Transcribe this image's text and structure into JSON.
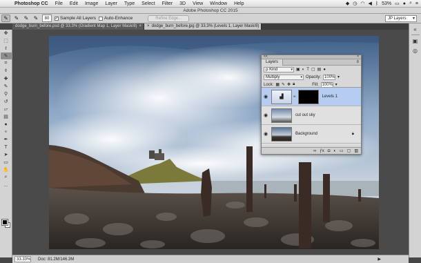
{
  "menubar": {
    "app_name": "Photoshop CC",
    "menus": [
      "File",
      "Edit",
      "Image",
      "Layer",
      "Type",
      "Select",
      "Filter",
      "3D",
      "View",
      "Window",
      "Help"
    ],
    "battery": "53%",
    "icons": [
      "apple-icon",
      "dropbox-icon",
      "clock-icon",
      "wifi-icon",
      "volume-icon",
      "bluetooth-icon",
      "battery-icon",
      "user-icon",
      "spotlight-icon",
      "list-icon"
    ]
  },
  "window_title": "Adobe Photoshop CC 2015",
  "options": {
    "brush_size": "80",
    "sample_all_layers": "Sample All Layers",
    "auto_enhance": "Auto-Enhance",
    "refine_edge": "Refine Edge...",
    "workspace": "JP Layers"
  },
  "tabs": [
    {
      "label": "dodge_burn_before.psd @ 33.3% (Gradient Map 1, Layer Mask/8)",
      "close": "×",
      "active": false
    },
    {
      "label": "dodge_burn_before.jpg @ 33.3% (Levels 1, Layer Mask/8)",
      "close": "×",
      "active": true
    }
  ],
  "status": {
    "zoom": "33.33%",
    "doc": "Doc: 81.2M/146.3M",
    "arrow": "▶"
  },
  "layers_panel": {
    "collapse": "<<",
    "close": "×",
    "tab": "Layers",
    "menu": "≡",
    "kind_label": "ρ Kind",
    "blend_mode": "Multiply",
    "opacity_label": "Opacity:",
    "opacity": "100%",
    "lock_label": "Lock:",
    "fill_label": "Fill:",
    "fill": "100%",
    "layers": [
      {
        "name": "Levels 1",
        "selected": true
      },
      {
        "name": "cut out sky",
        "selected": false
      },
      {
        "name": "Background",
        "selected": false
      }
    ]
  },
  "colors": {
    "selection": "#b6cdf1",
    "canvas_bg": "#4a4a4a",
    "ui_gray": "#d3d3d3"
  }
}
